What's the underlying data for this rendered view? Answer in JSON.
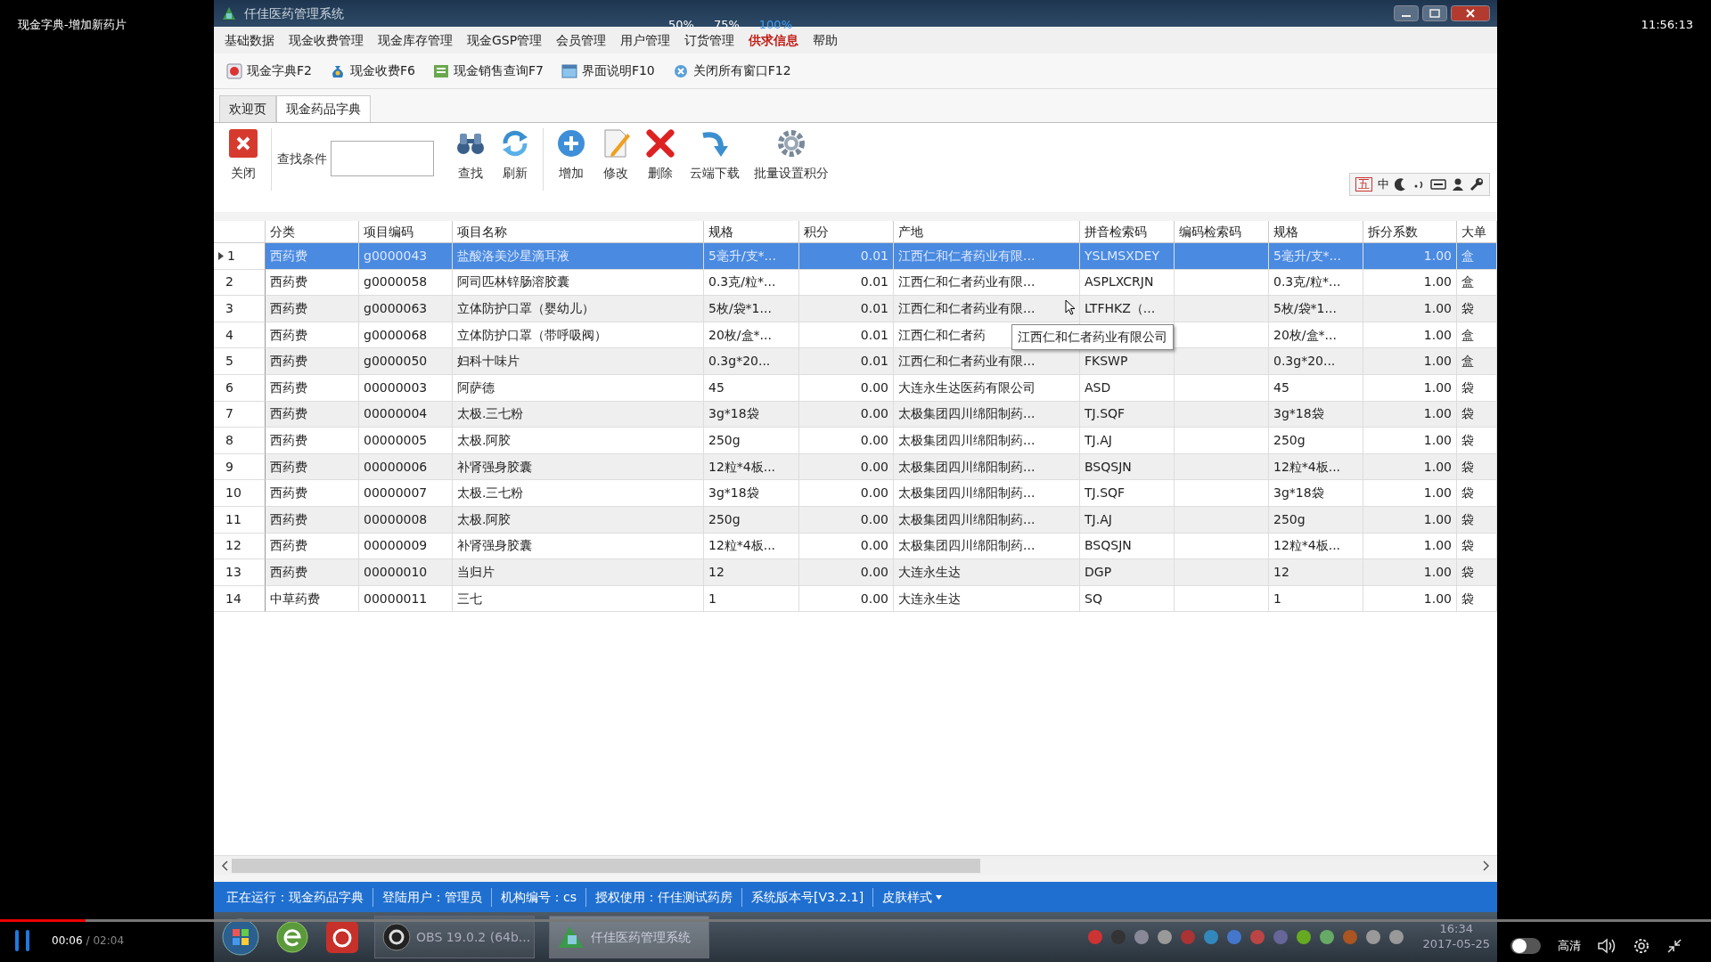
{
  "player": {
    "title": "现金字典-增加新药片",
    "clock": "11:56:13",
    "zoom_options": [
      {
        "label": "50%",
        "selected": false
      },
      {
        "label": "75%",
        "selected": false
      },
      {
        "label": "100%",
        "selected": true
      }
    ],
    "progress": {
      "level": 0.05
    },
    "elapsed": "00:06",
    "duration": "/ 02:04",
    "quality": "高清",
    "danmaku_on": false
  },
  "app": {
    "title": "仟佳医药管理系统",
    "menu": [
      {
        "label": "基础数据",
        "highlight": false
      },
      {
        "label": "现金收费管理",
        "highlight": false
      },
      {
        "label": "现金库存管理",
        "highlight": false
      },
      {
        "label": "现金GSP管理",
        "highlight": false
      },
      {
        "label": "会员管理",
        "highlight": false
      },
      {
        "label": "用户管理",
        "highlight": false
      },
      {
        "label": "订货管理",
        "highlight": false
      },
      {
        "label": "供求信息",
        "highlight": true
      },
      {
        "label": "帮助",
        "highlight": false
      }
    ],
    "shortcuts": [
      "现金字典F2",
      "现金收费F6",
      "现金销售查询F7",
      "界面说明F10",
      "关闭所有窗口F12"
    ],
    "tabs": [
      {
        "label": "欢迎页",
        "selected": false
      },
      {
        "label": "现金药品字典",
        "selected": true
      }
    ],
    "toolbar": {
      "close": "关闭",
      "search_label": "查找条件",
      "buttons": [
        "查找",
        "刷新",
        "增加",
        "修改",
        "删除",
        "云端下载",
        "批量设置积分"
      ],
      "ime": [
        "五",
        "中"
      ]
    },
    "table": {
      "columns": [
        "",
        "分类",
        "项目编码",
        "项目名称",
        "规格",
        "积分",
        "产地",
        "拼音检索码",
        "编码检索码",
        "规格",
        "拆分系数",
        "大单"
      ],
      "rows": [
        {
          "selected": true,
          "cells": [
            "1",
            "西药费",
            "g0000043",
            "盐酸洛美沙星滴耳液",
            "5毫升/支*...",
            "0.01",
            "江西仁和仁者药业有限...",
            "YSLMSXDEY",
            null,
            "5毫升/支*...",
            "1.00",
            "盒"
          ]
        },
        {
          "selected": false,
          "cells": [
            "2",
            "西药费",
            "g0000058",
            "阿司匹林锌肠溶胶囊",
            "0.3克/粒*...",
            "0.01",
            "江西仁和仁者药业有限...",
            "ASPLXCRJN",
            null,
            "0.3克/粒*...",
            "1.00",
            "盒"
          ]
        },
        {
          "selected": false,
          "cells": [
            "3",
            "西药费",
            "g0000063",
            "立体防护口罩（婴幼儿）",
            "5枚/袋*1...",
            "0.01",
            "江西仁和仁者药业有限...",
            "LTFHKZ（...",
            null,
            "5枚/袋*1...",
            "1.00",
            "袋"
          ]
        },
        {
          "selected": false,
          "cells": [
            "4",
            "西药费",
            "g0000068",
            "立体防护口罩（带呼吸阀）",
            "20枚/盒*...",
            "0.01",
            "江西仁和仁者药",
            null,
            null,
            "20枚/盒*...",
            "1.00",
            "盒"
          ]
        },
        {
          "selected": false,
          "cells": [
            "5",
            "西药费",
            "g0000050",
            "妇科十味片",
            "0.3g*20...",
            "0.01",
            "江西仁和仁者药业有限...",
            "FKSWP",
            null,
            "0.3g*20...",
            "1.00",
            "盒"
          ]
        },
        {
          "selected": false,
          "cells": [
            "6",
            "西药费",
            "00000003",
            "阿萨德",
            "45",
            "0.00",
            "大连永生达医药有限公司",
            "ASD",
            null,
            "45",
            "1.00",
            "袋"
          ]
        },
        {
          "selected": false,
          "cells": [
            "7",
            "西药费",
            "00000004",
            "太极.三七粉",
            "3g*18袋",
            "0.00",
            "太极集团四川绵阳制药...",
            "TJ.SQF",
            null,
            "3g*18袋",
            "1.00",
            "袋"
          ]
        },
        {
          "selected": false,
          "cells": [
            "8",
            "西药费",
            "00000005",
            "太极.阿胶",
            "250g",
            "0.00",
            "太极集团四川绵阳制药...",
            "TJ.AJ",
            null,
            "250g",
            "1.00",
            "袋"
          ]
        },
        {
          "selected": false,
          "cells": [
            "9",
            "西药费",
            "00000006",
            "补肾强身胶囊",
            "12粒*4板...",
            "0.00",
            "太极集团四川绵阳制药...",
            "BSQSJN",
            null,
            "12粒*4板...",
            "1.00",
            "袋"
          ]
        },
        {
          "selected": false,
          "cells": [
            "10",
            "西药费",
            "00000007",
            "太极.三七粉",
            "3g*18袋",
            "0.00",
            "太极集团四川绵阳制药...",
            "TJ.SQF",
            null,
            "3g*18袋",
            "1.00",
            "袋"
          ]
        },
        {
          "selected": false,
          "cells": [
            "11",
            "西药费",
            "00000008",
            "太极.阿胶",
            "250g",
            "0.00",
            "太极集团四川绵阳制药...",
            "TJ.AJ",
            null,
            "250g",
            "1.00",
            "袋"
          ]
        },
        {
          "selected": false,
          "cells": [
            "12",
            "西药费",
            "00000009",
            "补肾强身胶囊",
            "12粒*4板...",
            "0.00",
            "太极集团四川绵阳制药...",
            "BSQSJN",
            null,
            "12粒*4板...",
            "1.00",
            "袋"
          ]
        },
        {
          "selected": false,
          "cells": [
            "13",
            "西药费",
            "00000010",
            "当归片",
            "12",
            "0.00",
            "大连永生达",
            "DGP",
            null,
            "12",
            "1.00",
            "袋"
          ]
        },
        {
          "selected": false,
          "cells": [
            "14",
            "中草药费",
            "00000011",
            "三七",
            "1",
            "0.00",
            "大连永生达",
            "SQ",
            null,
            "1",
            "1.00",
            "袋"
          ]
        }
      ],
      "tooltip": "江西仁和仁者药业有限公司"
    },
    "status_bar": [
      "正在运行：现金药品字典",
      "登陆用户：管理员",
      "机构编号：cs",
      "授权使用：仟佳测试药房",
      "系统版本号[V3.2.1]"
    ],
    "skin": "皮肤样式"
  },
  "taskbar": {
    "buttons": [
      {
        "label": "OBS 19.0.2 (64b...",
        "selected": false
      },
      {
        "label": "仟佳医药管理系统",
        "selected": true
      }
    ],
    "time": "16:34",
    "date": "2017-05-25"
  }
}
